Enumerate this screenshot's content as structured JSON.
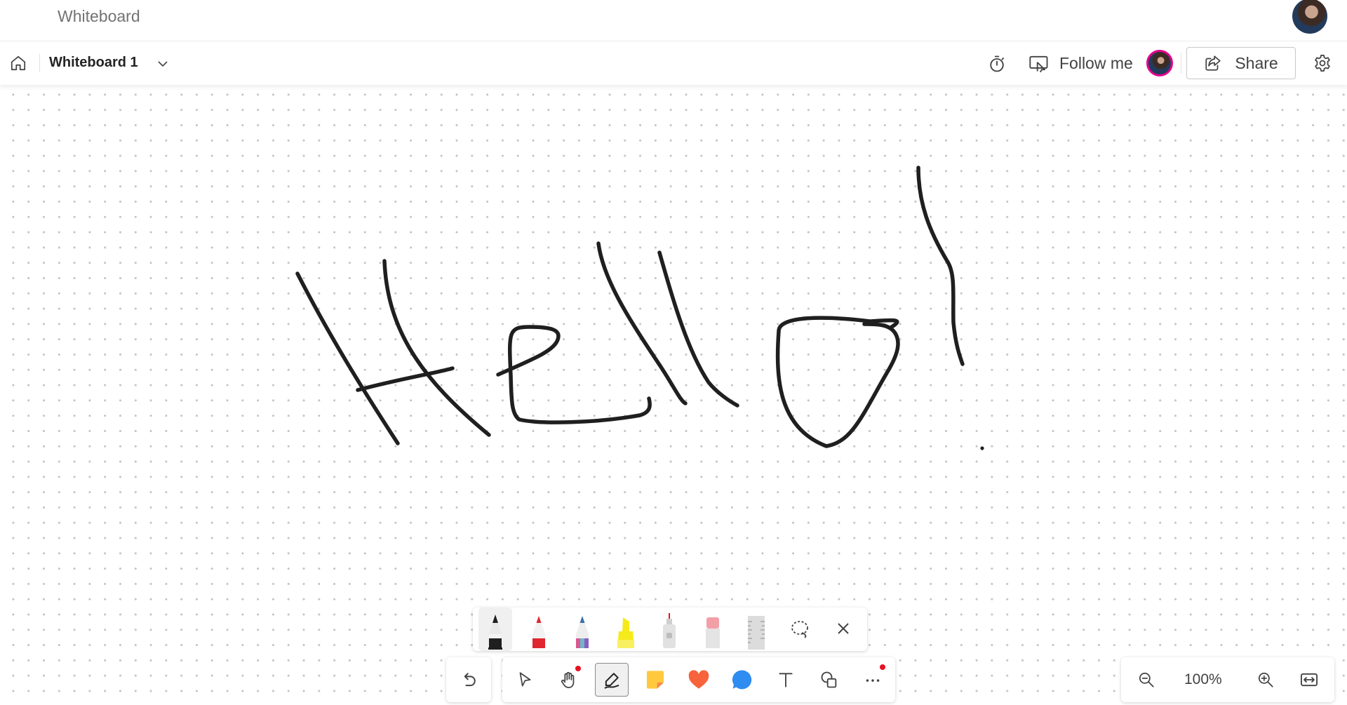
{
  "app": {
    "title": "Whiteboard"
  },
  "toolbar": {
    "board_name": "Whiteboard 1",
    "follow_label": "Follow me",
    "share_label": "Share"
  },
  "icons": {
    "home": "home-icon",
    "chevron": "chevron-down-icon",
    "timer": "timer-icon",
    "follow": "present-to-all-icon",
    "share": "share-icon",
    "settings": "gear-icon",
    "undo": "undo-icon",
    "select": "pointer-icon",
    "pan": "hand-icon",
    "inking": "pen-icon",
    "sticky": "sticky-note-icon",
    "reaction": "heart-icon",
    "comment": "speech-bubble-icon",
    "text": "text-icon",
    "shapes": "shapes-icon",
    "more": "ellipsis-icon",
    "lasso": "lasso-icon",
    "close": "close-icon",
    "zoom_out": "zoom-out-icon",
    "zoom_in": "zoom-in-icon",
    "fit": "fit-to-screen-icon"
  },
  "pens": [
    {
      "name": "black-pen",
      "color": "#1f1f1f",
      "selected": true
    },
    {
      "name": "red-pen",
      "color": "#e0262f",
      "selected": false
    },
    {
      "name": "rainbow-pen",
      "color": "#6fb6c6",
      "selected": false
    },
    {
      "name": "yellow-highlighter",
      "color": "#f5ea1a",
      "selected": false
    },
    {
      "name": "laser-pointer",
      "color": "#d0d0d0",
      "selected": false
    },
    {
      "name": "eraser",
      "color": "#f2a0a8",
      "selected": false
    },
    {
      "name": "ruler",
      "color": "#d8d8d8",
      "selected": false
    }
  ],
  "zoom": {
    "level": "100%"
  },
  "colors": {
    "accent_presenter": "#e3008c",
    "notification_dot": "#e81123",
    "ink": "#1f1f1f"
  }
}
